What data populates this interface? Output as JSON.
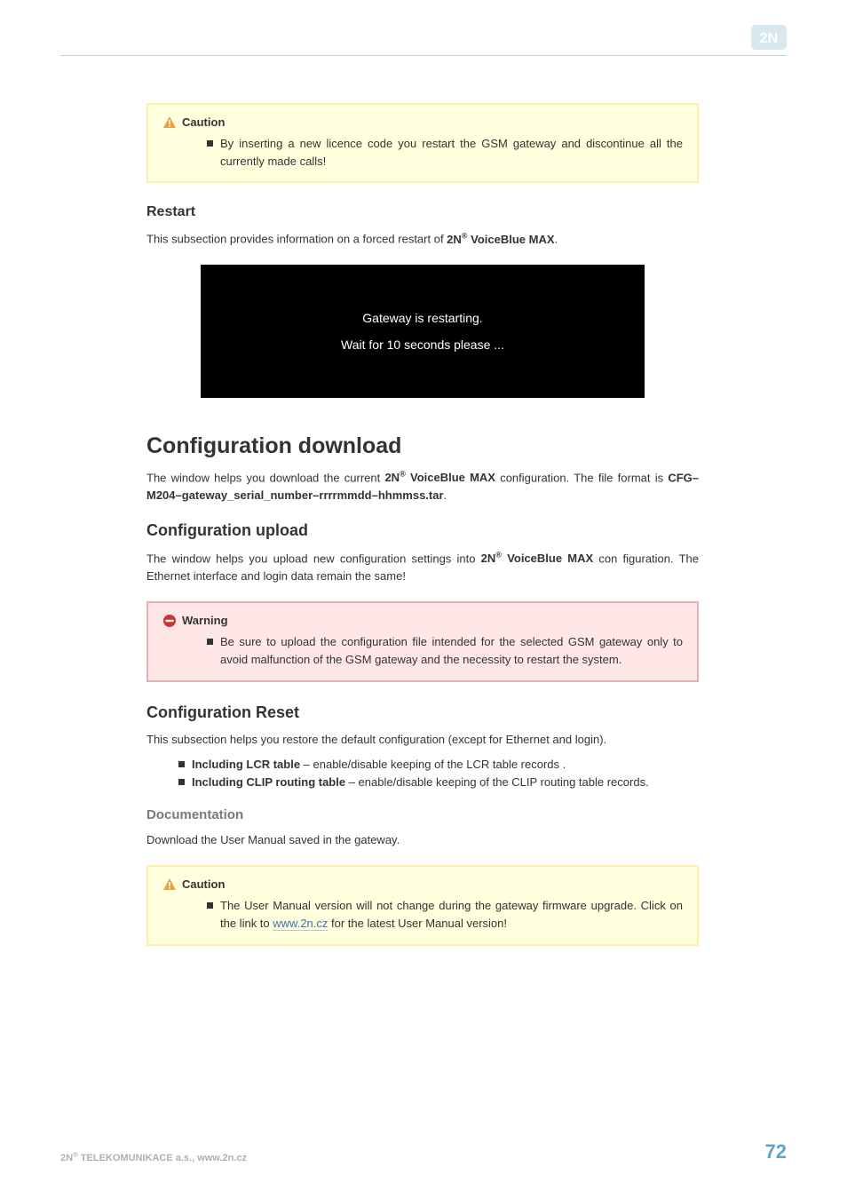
{
  "logo_alt": "2N",
  "caution1": {
    "title": "Caution",
    "body": "By inserting a new licence code you restart the GSM gateway and discontinue all the currently made calls!"
  },
  "restart": {
    "heading": "Restart",
    "para_pre": "This subsection provides information on a forced restart of ",
    "product_prefix": "2N",
    "product_suffix": " VoiceBlue MAX",
    "para_post": ".",
    "screenshot_line1": "Gateway is restarting.",
    "screenshot_line2": "Wait for 10 seconds please ..."
  },
  "config_download": {
    "heading": "Configuration download",
    "para_pre": "The window helps you download the current ",
    "product_prefix": "2N",
    "product_suffix": " VoiceBlue MAX",
    "para_mid": " configuration. The file format is ",
    "fileformat": "CFG–M204–gateway_serial_number–rrrrmmdd–hhmmss.tar",
    "para_post": "."
  },
  "config_upload": {
    "heading": "Configuration upload",
    "para_pre": "The window helps you upload new configuration settings into ",
    "product_prefix": "2N",
    "product_suffix": " VoiceBlue MAX",
    "para_post": " con figuration. The Ethernet interface and login data remain the same!"
  },
  "warning1": {
    "title": "Warning",
    "body": "Be sure to upload the configuration file intended for the selected GSM gateway only to avoid malfunction of the GSM gateway and the necessity to restart the system."
  },
  "config_reset": {
    "heading": "Configuration Reset",
    "para": "This subsection helps you restore the default configuration (except for Ethernet and login).",
    "item1_label": "Including LCR table",
    "item1_body": " – enable/disable keeping of the LCR table records .",
    "item2_label": "Including CLIP routing table",
    "item2_body": " – enable/disable keeping of the CLIP routing table records."
  },
  "documentation": {
    "heading": "Documentation",
    "para": "Download the User Manual saved in the gateway."
  },
  "caution2": {
    "title": "Caution",
    "body_pre": " The User Manual version will not change during the gateway firmware upgrade. Click on the link to ",
    "link_text": "www.2n.cz",
    "body_post": " for the latest User Manual version!"
  },
  "footer": {
    "left_pre": "2N",
    "left_post": " TELEKOMUNIKACE a.s., www.2n.cz",
    "page": "72"
  }
}
